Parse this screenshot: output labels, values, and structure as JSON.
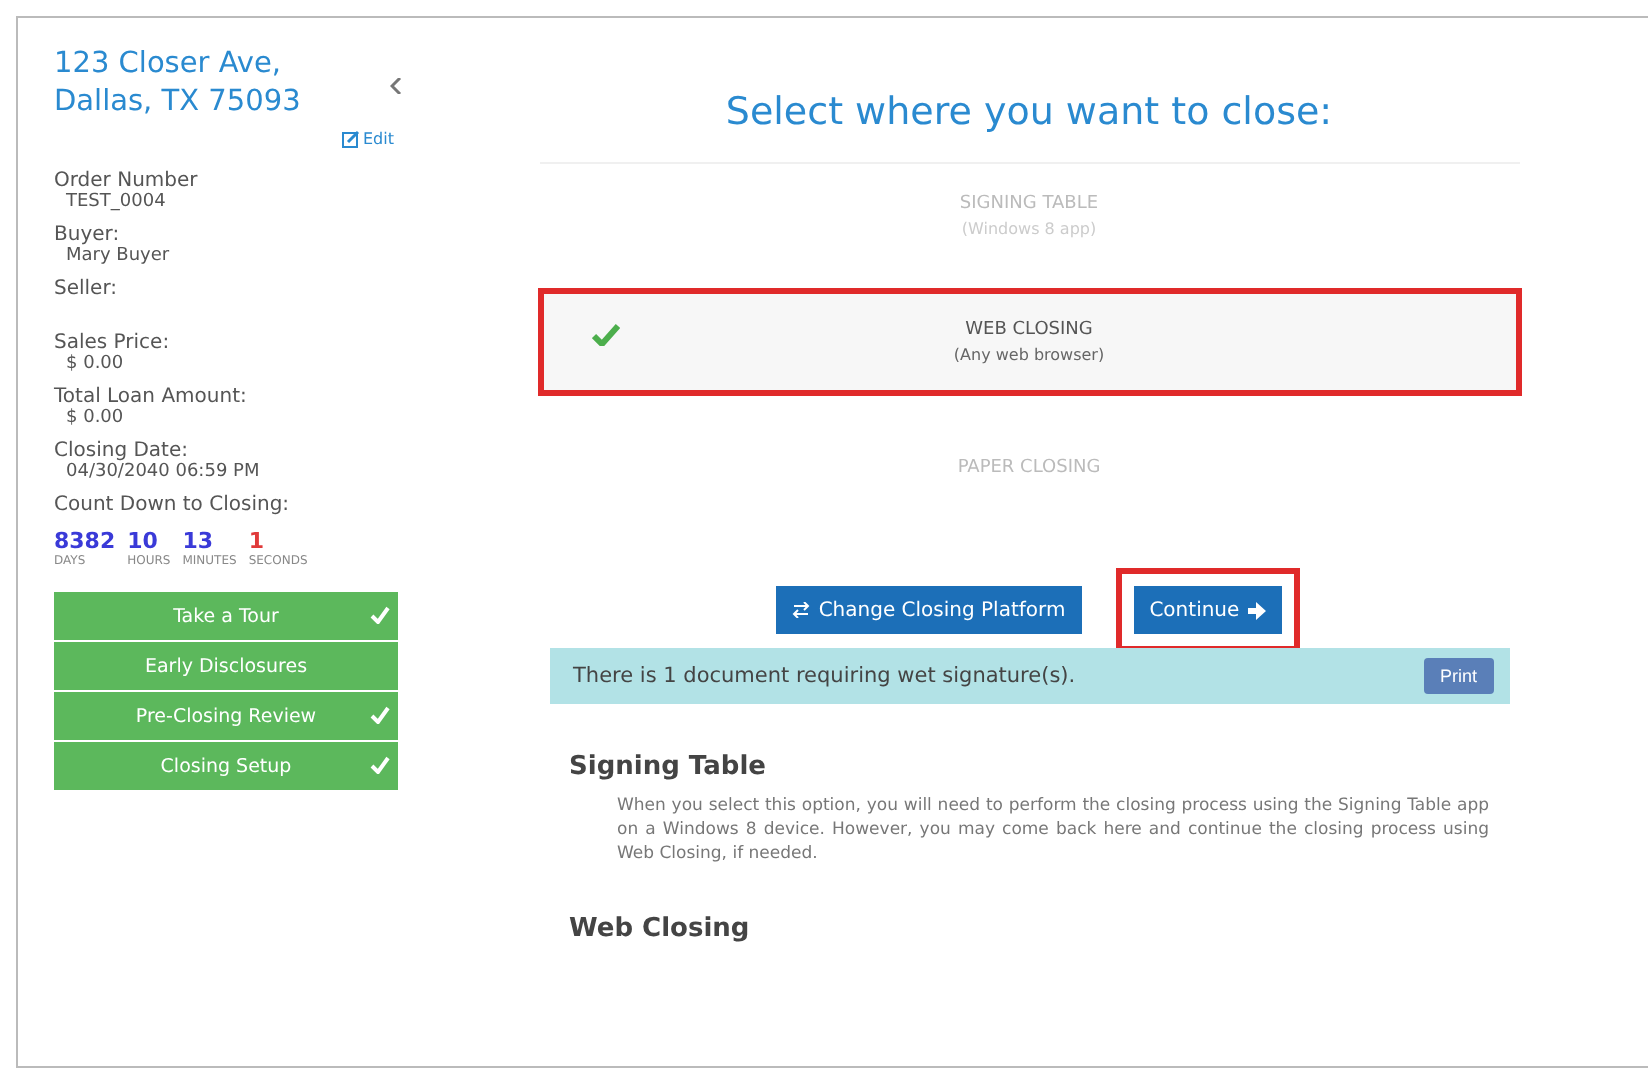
{
  "sidebar": {
    "address": "123 Closer Ave, Dallas, TX 75093",
    "edit": "Edit",
    "fields": [
      {
        "label": "Order Number",
        "value": "TEST_0004"
      },
      {
        "label": "Buyer:",
        "value": "Mary Buyer"
      },
      {
        "label": "Seller:"
      },
      {
        "label": "Sales Price:",
        "value": "$ 0.00"
      },
      {
        "label": "Total Loan Amount:",
        "value": "$ 0.00"
      },
      {
        "label": "Closing Date:",
        "value": "04/30/2040 06:59 PM"
      }
    ],
    "countdown_label": "Count Down to Closing:",
    "countdown": [
      {
        "value": "8382",
        "unit": "DAYS",
        "color": "#3a3ad8"
      },
      {
        "value": "10",
        "unit": "HOURS",
        "color": "#3a3ad8"
      },
      {
        "value": "13",
        "unit": "MINUTES",
        "color": "#3a3ad8"
      },
      {
        "value": "1",
        "unit": "SECONDS",
        "color": "#e03a3a"
      }
    ],
    "steps": [
      {
        "label": "Take a Tour",
        "done": true
      },
      {
        "label": "Early Disclosures",
        "done": false
      },
      {
        "label": "Pre-Closing Review",
        "done": true
      },
      {
        "label": "Closing Setup",
        "done": true
      }
    ]
  },
  "main": {
    "title": "Select where you want to close:",
    "options": [
      {
        "name": "SIGNING TABLE",
        "note": "(Windows 8 app)",
        "selected": false
      },
      {
        "name": "WEB CLOSING",
        "note": "(Any web browser)",
        "selected": true
      },
      {
        "name": "PAPER CLOSING",
        "selected": false
      }
    ],
    "buttons": [
      {
        "label": "Change Closing Platform",
        "kind": "change",
        "highlighted": false
      },
      {
        "label": "Continue",
        "kind": "continue",
        "highlighted": true
      }
    ],
    "notice": "There is 1 document requiring wet signature(s).",
    "print": "Print",
    "sections": [
      {
        "heading": "Signing Table",
        "body": "When you select this option, you will need to perform the closing process using the Signing Table app on a Windows 8 device. However, you may come back here and continue the closing process using Web Closing, if needed."
      },
      {
        "heading": "Web Closing"
      }
    ]
  }
}
